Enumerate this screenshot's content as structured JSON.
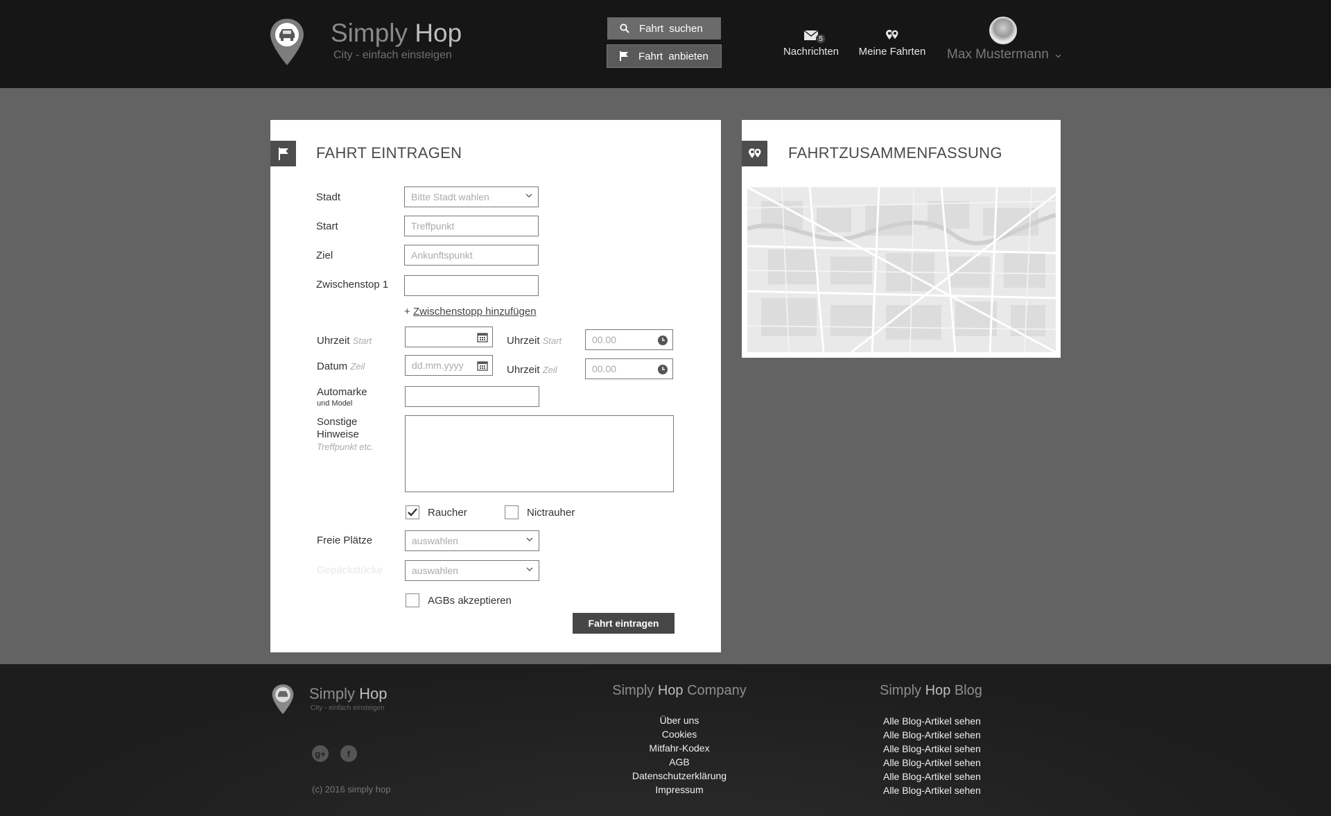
{
  "header": {
    "brand_light": "Simply",
    "brand_bold": "Hop",
    "tagline": "City - einfach einsteigen",
    "search_button": "Fahrt  suchen",
    "offer_button": "Fahrt  anbieten",
    "messages_label": "Nachrichten",
    "messages_count": "5",
    "my_rides_label": "Meine Fahrten",
    "user_name": "Max Mustermann"
  },
  "form": {
    "title": "FAHRT EINTRAGEN",
    "city_label": "Stadt",
    "city_placeholder": "Bitte Stadt wahlen",
    "start_label": "Start",
    "start_placeholder": "Treffpunkt",
    "dest_label": "Ziel",
    "dest_placeholder": "Ankunftspunkt",
    "stop_label": "Zwischenstop 1",
    "add_stop_plus": "+",
    "add_stop_link": "Zwischenstopp hinzufügen",
    "time_label": "Uhrzeit",
    "time_label_hint": "Start",
    "date_label": "Datum",
    "date_label_hint": "Zeil",
    "date_placeholder": "dd.mm.yyyy",
    "time_start_label": "Uhrzeit",
    "time_start_hint": "Start",
    "time_start_placeholder": "00.00",
    "time_end_label": "Uhrzeit",
    "time_end_hint": "Zeil",
    "time_end_placeholder": "00.00",
    "car_label": "Automarke",
    "car_label_sub": "und Model",
    "notes_label_1": "Sonstige",
    "notes_label_2": "Hinweise",
    "notes_hint": "Treffpunkt etc.",
    "smoker_label": "Raucher",
    "nonsmoker_label": "Nictrauher",
    "seats_label": "Freie Plätze",
    "seats_placeholder": "auswahlen",
    "luggage_label": "Gepäckstücke",
    "luggage_placeholder": "auswahlen",
    "agb_label": "AGBs akzeptieren",
    "submit_label": "Fahrt eintragen"
  },
  "summary": {
    "title": "FAHRTZUSAMMENFASSUNG"
  },
  "footer": {
    "brand_light": "Simply",
    "brand_bold": "Hop",
    "tagline": "City - einfach einsteigen",
    "copyright": "(c) 2016 simply hop",
    "company_light": "Simply",
    "company_bold": "Hop",
    "company_rest": "Company",
    "company_links": [
      "Über uns",
      "Cookies",
      "Mitfahr-Kodex",
      "AGB",
      "Datenschutzerklärung",
      "Impressum"
    ],
    "blog_light": "Simply",
    "blog_bold": "Hop",
    "blog_rest": "Blog",
    "blog_links": [
      "Alle Blog-Artikel sehen",
      "Alle Blog-Artikel sehen",
      "Alle Blog-Artikel sehen",
      "Alle Blog-Artikel sehen",
      "Alle Blog-Artikel sehen",
      "Alle Blog-Artikel sehen"
    ]
  },
  "state": {
    "smoker_checked": true,
    "nonsmoker_checked": false,
    "agb_checked": false
  },
  "colors": {
    "header_bg": "#161616",
    "page_bg": "#636363",
    "panel_bg": "#ffffff",
    "button_dark": "#474747"
  }
}
